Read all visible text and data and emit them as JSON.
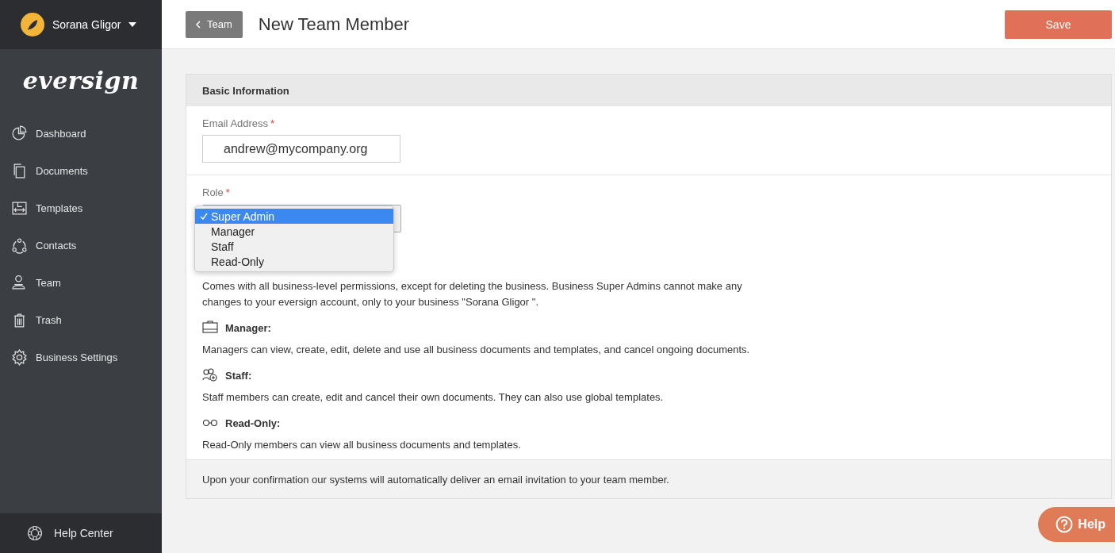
{
  "account": {
    "name": "Sorana Gligor"
  },
  "logo": "eversign",
  "sidebar": {
    "items": [
      {
        "label": "Dashboard",
        "kind": "dashboard"
      },
      {
        "label": "Documents",
        "kind": "documents"
      },
      {
        "label": "Templates",
        "kind": "templates"
      },
      {
        "label": "Contacts",
        "kind": "contacts"
      },
      {
        "label": "Team",
        "kind": "team"
      },
      {
        "label": "Trash",
        "kind": "trash"
      },
      {
        "label": "Business Settings",
        "kind": "settings"
      }
    ],
    "footer": "Help Center"
  },
  "topbar": {
    "back": "Team",
    "title": "New Team Member",
    "save": "Save"
  },
  "card": {
    "header": "Basic Information",
    "email": {
      "label": "Email Address",
      "required": "*",
      "value": "andrew@mycompany.org"
    },
    "role": {
      "label": "Role",
      "required": "*",
      "options": [
        {
          "label": "Super Admin",
          "selected": true
        },
        {
          "label": "Manager",
          "selected": false
        },
        {
          "label": "Staff",
          "selected": false
        },
        {
          "label": "Read-Only",
          "selected": false
        }
      ]
    },
    "roles": [
      {
        "description": "Comes with all business-level permissions, except for deleting the business. Business Super Admins cannot make any changes to your eversign account, only to your business \"Sorana Gligor \"."
      },
      {
        "kind": "manager",
        "title": "Manager:",
        "description": "Managers can view, create, edit, delete and use all business documents and templates, and cancel ongoing documents."
      },
      {
        "kind": "staff",
        "title": "Staff:",
        "description": "Staff members can create, edit and cancel their own documents. They can also use global templates."
      },
      {
        "kind": "read_only",
        "title": "Read-Only:",
        "description": "Read-Only members can view all business documents and templates."
      }
    ],
    "footer": "Upon your confirmation our systems will automatically deliver an email invitation to your team member."
  },
  "help": "Help"
}
